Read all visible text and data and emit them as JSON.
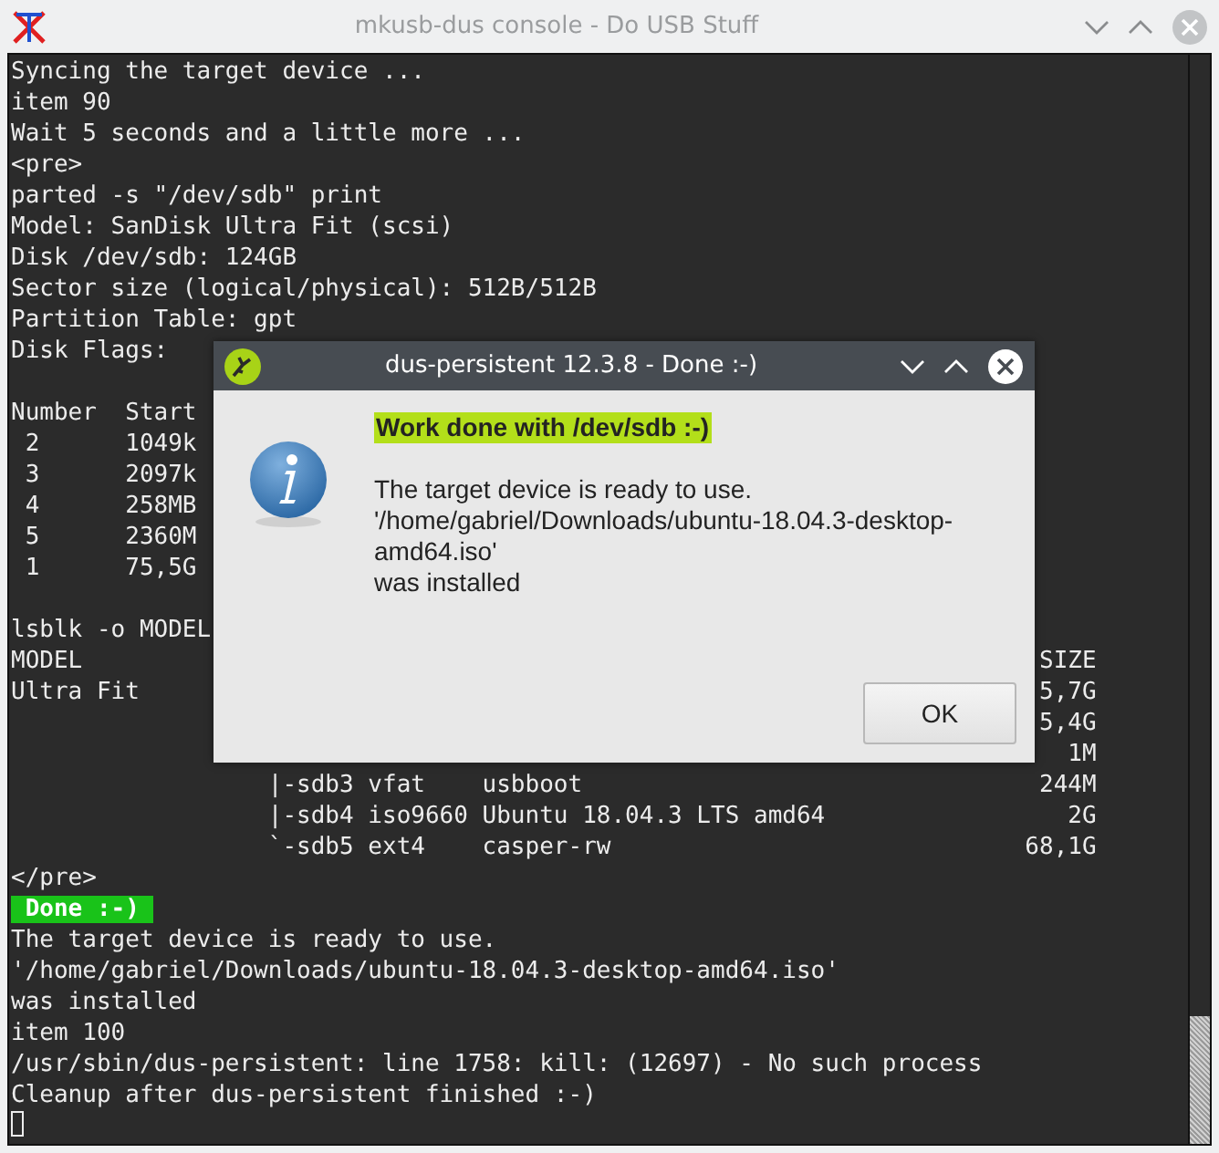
{
  "window": {
    "title": "mkusb-dus console - Do USB Stuff"
  },
  "terminal": {
    "lines": [
      {
        "kind": "text",
        "text": "Syncing the target device ..."
      },
      {
        "kind": "text",
        "text": "item 90"
      },
      {
        "kind": "text",
        "text": "Wait 5 seconds and a little more ..."
      },
      {
        "kind": "text",
        "text": "<pre>"
      },
      {
        "kind": "text",
        "text": "parted -s \"/dev/sdb\" print"
      },
      {
        "kind": "text",
        "text": "Model: SanDisk Ultra Fit (scsi)"
      },
      {
        "kind": "text",
        "text": "Disk /dev/sdb: 124GB"
      },
      {
        "kind": "text",
        "text": "Sector size (logical/physical): 512B/512B"
      },
      {
        "kind": "text",
        "text": "Partition Table: gpt"
      },
      {
        "kind": "text",
        "text": "Disk Flags:"
      },
      {
        "kind": "blank"
      },
      {
        "kind": "text",
        "text": "Number  Start"
      },
      {
        "kind": "text",
        "text": " 2      1049k"
      },
      {
        "kind": "text",
        "text": " 3      2097k"
      },
      {
        "kind": "text",
        "text": " 4      258MB"
      },
      {
        "kind": "text",
        "text": " 5      2360M"
      },
      {
        "kind": "text",
        "text": " 1      75,5G"
      },
      {
        "kind": "blank"
      },
      {
        "kind": "text",
        "text": "lsblk -o MODEL"
      },
      {
        "kind": "text",
        "text": "MODEL",
        "right": "SIZE"
      },
      {
        "kind": "text",
        "text": "Ultra Fit",
        "right": "5,7G"
      },
      {
        "kind": "text",
        "right": "5,4G"
      },
      {
        "kind": "text",
        "right": "1M"
      },
      {
        "kind": "text",
        "text": "                  |-sdb3 vfat    usbboot",
        "right": "244M"
      },
      {
        "kind": "text",
        "text": "                  |-sdb4 iso9660 Ubuntu 18.04.3 LTS amd64",
        "right": "2G"
      },
      {
        "kind": "text",
        "text": "                  `-sdb5 ext4    casper-rw",
        "right": "68,1G"
      },
      {
        "kind": "text",
        "text": "</pre>"
      },
      {
        "kind": "badge",
        "text": " Done :-) "
      },
      {
        "kind": "text",
        "text": "The target device is ready to use."
      },
      {
        "kind": "text",
        "text": "'/home/gabriel/Downloads/ubuntu-18.04.3-desktop-amd64.iso'"
      },
      {
        "kind": "text",
        "text": "was installed"
      },
      {
        "kind": "text",
        "text": "item 100"
      },
      {
        "kind": "text",
        "text": "/usr/sbin/dus-persistent: line 1758: kill: (12697) - No such process"
      },
      {
        "kind": "text",
        "text": "Cleanup after dus-persistent finished :-)"
      },
      {
        "kind": "cursor"
      }
    ]
  },
  "dialog": {
    "title": "dus-persistent 12.3.8 - Done :-)",
    "heading": "Work done with /dev/sdb :-)",
    "message_lines": [
      "The target device is ready to use.",
      "'/home/gabriel/Downloads/ubuntu-18.04.3-desktop-amd64.iso'",
      "was installed"
    ],
    "buttons": [
      "OK"
    ]
  }
}
